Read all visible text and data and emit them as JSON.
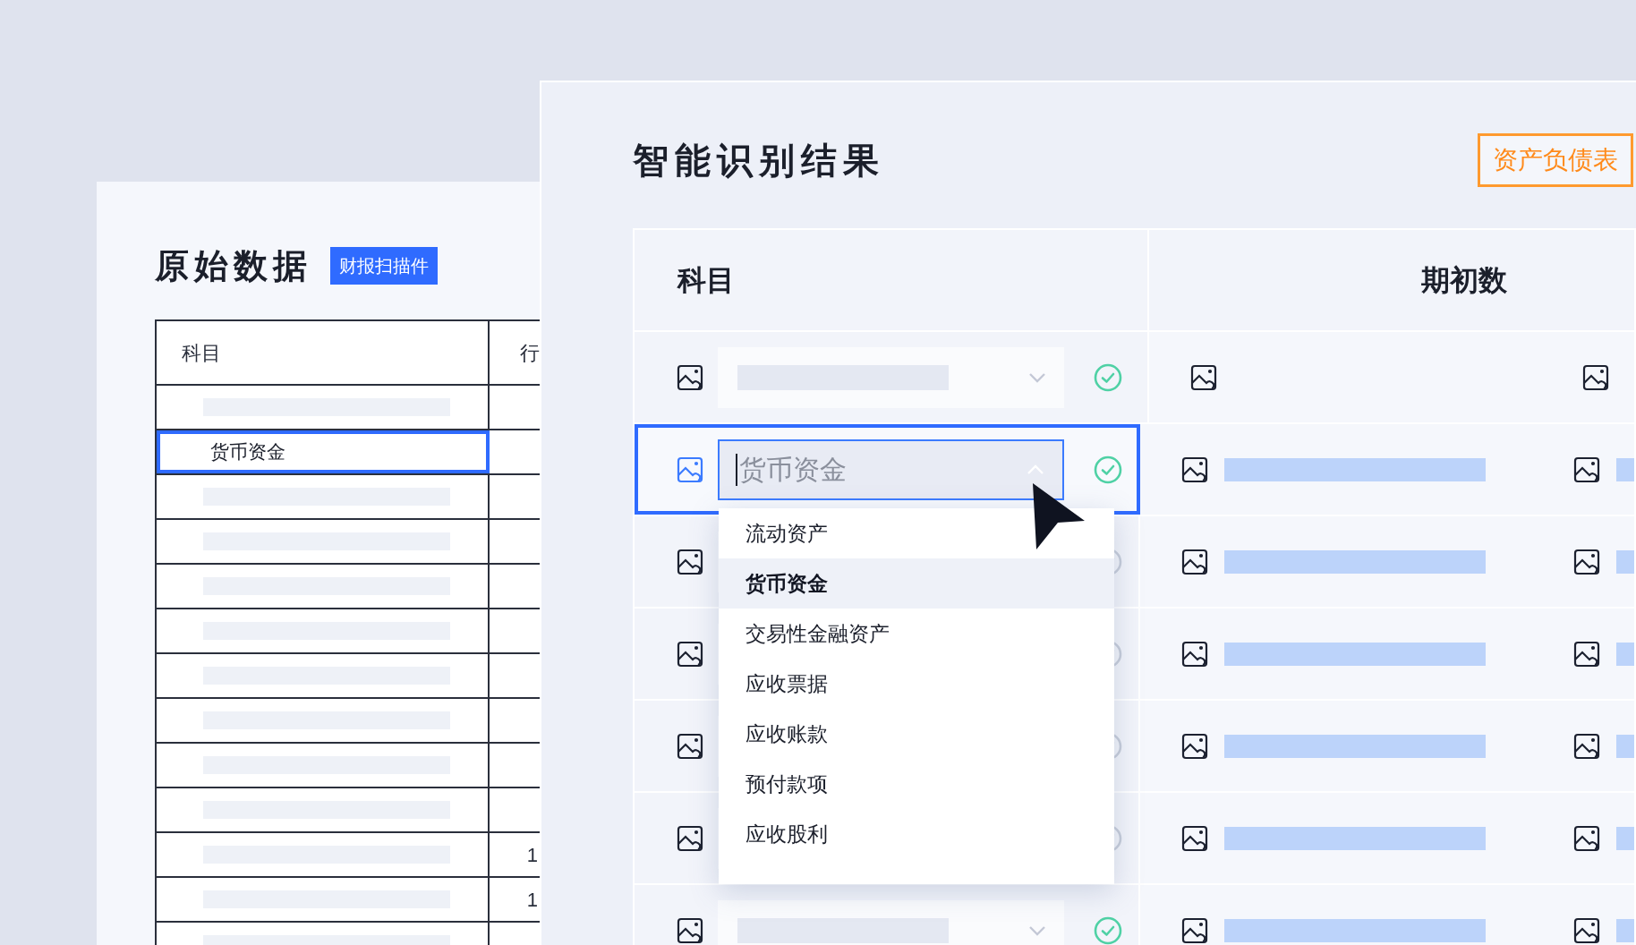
{
  "source_panel": {
    "title": "原始数据",
    "badge": "财报扫描件",
    "table": {
      "columns": [
        "科目",
        "行"
      ],
      "rows": [
        {
          "selected": false
        },
        {
          "subject": "货币资金",
          "selected": true
        },
        {
          "selected": false
        },
        {
          "selected": false
        },
        {
          "selected": false
        },
        {
          "selected": false
        },
        {
          "selected": false
        },
        {
          "selected": false
        },
        {
          "selected": false
        },
        {
          "selected": false
        },
        {
          "column_2": "1",
          "selected": false
        },
        {
          "column_2": "1",
          "selected": false
        },
        {
          "selected": false
        }
      ]
    }
  },
  "result_panel": {
    "title": "智能识别结果",
    "statement_button": "资产负债表",
    "table": {
      "columns": [
        "科目",
        "期初数"
      ],
      "rows": [
        {
          "selected": false,
          "confirmed": true,
          "has_value": false
        },
        {
          "selected": true,
          "confirmed": true,
          "has_value": true,
          "field": {
            "value": "货币资金",
            "expanded": true
          }
        },
        {
          "selected": false,
          "confirmed": false,
          "has_value": true
        },
        {
          "selected": false,
          "confirmed": false,
          "has_value": true
        },
        {
          "selected": false,
          "confirmed": false,
          "has_value": true
        },
        {
          "selected": false,
          "confirmed": false,
          "has_value": true
        },
        {
          "selected": false,
          "confirmed": true,
          "has_value": true
        }
      ]
    },
    "dropdown": {
      "options": [
        {
          "label": "流动资产",
          "selected": false
        },
        {
          "label": "货币资金",
          "selected": true
        },
        {
          "label": "交易性金融资产",
          "selected": false
        },
        {
          "label": "应收票据",
          "selected": false
        },
        {
          "label": "应收账款",
          "selected": false
        },
        {
          "label": "预付款项",
          "selected": false
        },
        {
          "label": "应收股利",
          "selected": false
        }
      ]
    }
  }
}
